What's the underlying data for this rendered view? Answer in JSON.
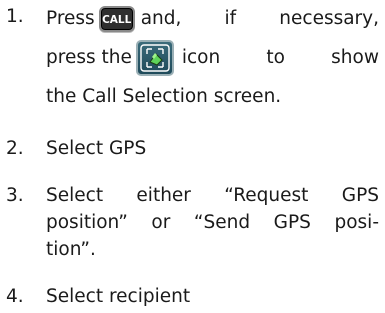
{
  "steps": [
    {
      "num": "1.",
      "line1_a": "Press",
      "call_key": "CALL",
      "line1_b": "and, if necessary,",
      "line2_a": "press the",
      "line2_b": "icon to show",
      "line3": "the Call Selection screen."
    },
    {
      "num": "2.",
      "text": "Select GPS"
    },
    {
      "num": "3.",
      "line1": "Select either “Request GPS",
      "line2": "position” or “Send GPS posi-",
      "line3": "tion”."
    },
    {
      "num": "4.",
      "text": "Select recipient"
    }
  ],
  "icons": {
    "call_key": "call-key-icon",
    "call_selection": "call-selection-icon"
  }
}
